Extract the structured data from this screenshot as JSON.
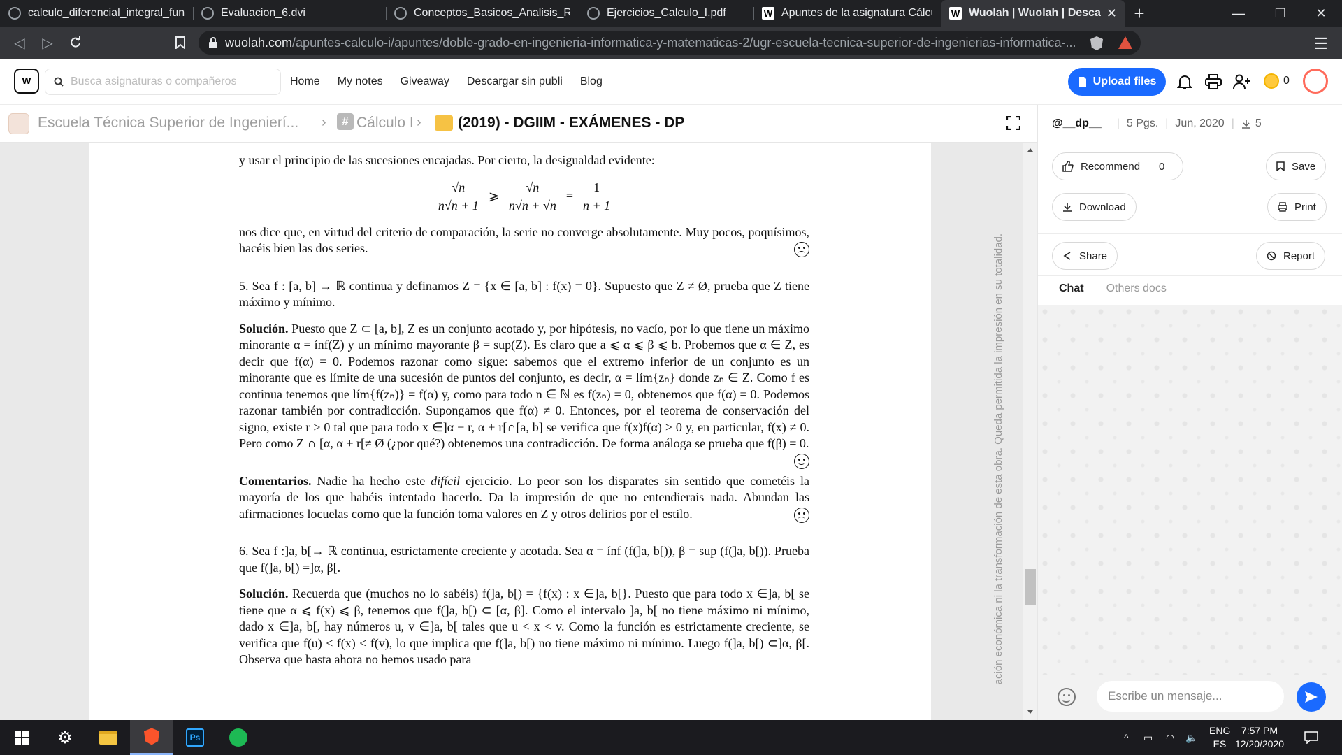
{
  "browser": {
    "tabs": [
      {
        "title": "calculo_diferencial_integral_func_u",
        "icon": "globe-icon",
        "active": false
      },
      {
        "title": "Evaluacion_6.dvi",
        "icon": "globe-icon",
        "active": false
      },
      {
        "title": "Conceptos_Basicos_Analisis_Real.p",
        "icon": "globe-icon",
        "active": false
      },
      {
        "title": "Ejercicios_Calculo_I.pdf",
        "icon": "globe-icon",
        "active": false
      },
      {
        "title": "Apuntes de la asignatura Cálculo I",
        "icon": "wuolah-icon",
        "active": false
      },
      {
        "title": "Wuolah | Wuolah | Descarga",
        "icon": "wuolah-icon",
        "active": true
      }
    ],
    "url_domain": "wuolah.com",
    "url_path": "/apuntes-calculo-i/apuntes/doble-grado-en-ingenieria-informatica-y-matematicas-2/ugr-escuela-tecnica-superior-de-ingenierias-informatica-..."
  },
  "site": {
    "logo": "w",
    "search_placeholder": "Busca asignaturas o compañeros",
    "nav": [
      "Home",
      "My notes",
      "Giveaway",
      "Descargar sin publi",
      "Blog"
    ],
    "upload_label": "Upload files",
    "coins": "0",
    "accent": "#1a6aff"
  },
  "breadcrumb": {
    "school": "Escuela Técnica Superior de Ingenierí...",
    "subject": "Cálculo I",
    "folder": "(2019) - DGIIM - EXÁMENES - DP"
  },
  "doc": {
    "p1": "y usar el principio de las sucesiones encajadas. Por cierto, la desigualdad evidente:",
    "f1_num1": "√n",
    "f1_den1": "n√n + 1",
    "f1_rel1": "⩾",
    "f1_num2": "√n",
    "f1_den2": "n√n + √n",
    "f1_rel2": "=",
    "f1_num3": "1",
    "f1_den3": "n + 1",
    "p2": "nos dice que, en virtud del criterio de comparación, la serie no converge absolutamente. Muy pocos, poquísimos, hacéis bien las dos series.",
    "q5": "5. Sea f : [a, b] → ℝ continua y definamos Z = {x ∈ [a, b] : f(x) = 0}. Supuesto que Z ≠ Ø, prueba que Z tiene máximo y mínimo.",
    "sol5_label": "Solución.",
    "sol5": " Puesto que Z ⊂ [a, b], Z es un conjunto acotado y, por hipótesis, no vacío, por lo que tiene un máximo minorante α = ínf(Z) y un mínimo mayorante β = sup(Z). Es claro que a ⩽ α ⩽ β ⩽ b. Probemos que α ∈ Z, es decir que f(α) = 0. Podemos razonar como sigue: sabemos que el extremo inferior de un conjunto es un minorante que es límite de una sucesión de puntos del conjunto, es decir, α = lím{zₙ} donde zₙ ∈ Z. Como f es continua tenemos que lím{f(zₙ)} = f(α) y, como para todo n ∈ ℕ es f(zₙ) = 0, obtenemos que f(α) = 0. Podemos razonar también por contradicción. Supongamos que f(α) ≠ 0. Entonces, por el teorema de conservación del signo, existe r > 0 tal que para todo x ∈]α − r, α + r[∩[a, b] se verifica que f(x)f(α) > 0 y, en particular, f(x) ≠ 0. Pero como Z ∩ [α, α + r[≠ Ø (¿por qué?) obtenemos una contradicción. De forma análoga se prueba que f(β) = 0.",
    "com_label": "Comentarios.",
    "com_a": " Nadie ha hecho este ",
    "com_em": "difícil",
    "com_b": " ejercicio. Lo peor son los disparates sin sentido que cometéis la mayoría de los que habéis intentado hacerlo. Da la impresión de que no entendierais nada. Abundan las afirmaciones locuelas como que la función toma valores en Z y otros delirios por el estilo.",
    "q6": "6. Sea f :]a, b[→ ℝ continua, estrictamente creciente y acotada. Sea α = ínf (f(]a, b[)), β = sup (f(]a, b[)). Prueba que f(]a, b[) =]α, β[.",
    "sol6_label": "Solución.",
    "sol6": " Recuerda que (muchos no lo sabéis) f(]a, b[) = {f(x) : x ∈]a, b[}. Puesto que para todo x ∈]a, b[ se tiene que α ⩽ f(x) ⩽ β, tenemos que f(]a, b[) ⊂ [α, β]. Como el intervalo ]a, b[ no tiene máximo ni mínimo, dado x ∈]a, b[, hay números u, v ∈]a, b[ tales que u < x < v. Como la función es estrictamente creciente, se verifica que f(u) < f(x) < f(v), lo que implica que f(]a, b[) no tiene máximo ni mínimo. Luego f(]a, b[) ⊂]α, β[. Observa que hasta ahora no hemos usado para",
    "watermark": "ación económica ni la transformación de esta obra. Queda permitida la impresión en su totalidad."
  },
  "panel": {
    "user": "@__dp__",
    "pages": "5 Pgs.",
    "date": "Jun, 2020",
    "downloads": "5",
    "recommend_label": "Recommend",
    "recommend_count": "0",
    "save_label": "Save",
    "download_label": "Download",
    "print_label": "Print",
    "share_label": "Share",
    "report_label": "Report",
    "tab_chat": "Chat",
    "tab_others": "Others docs",
    "message_placeholder": "Escribe un mensaje..."
  },
  "taskbar": {
    "lang_top": "ENG",
    "lang_bottom": "ES",
    "time": "7:57 PM",
    "date": "12/20/2020"
  }
}
